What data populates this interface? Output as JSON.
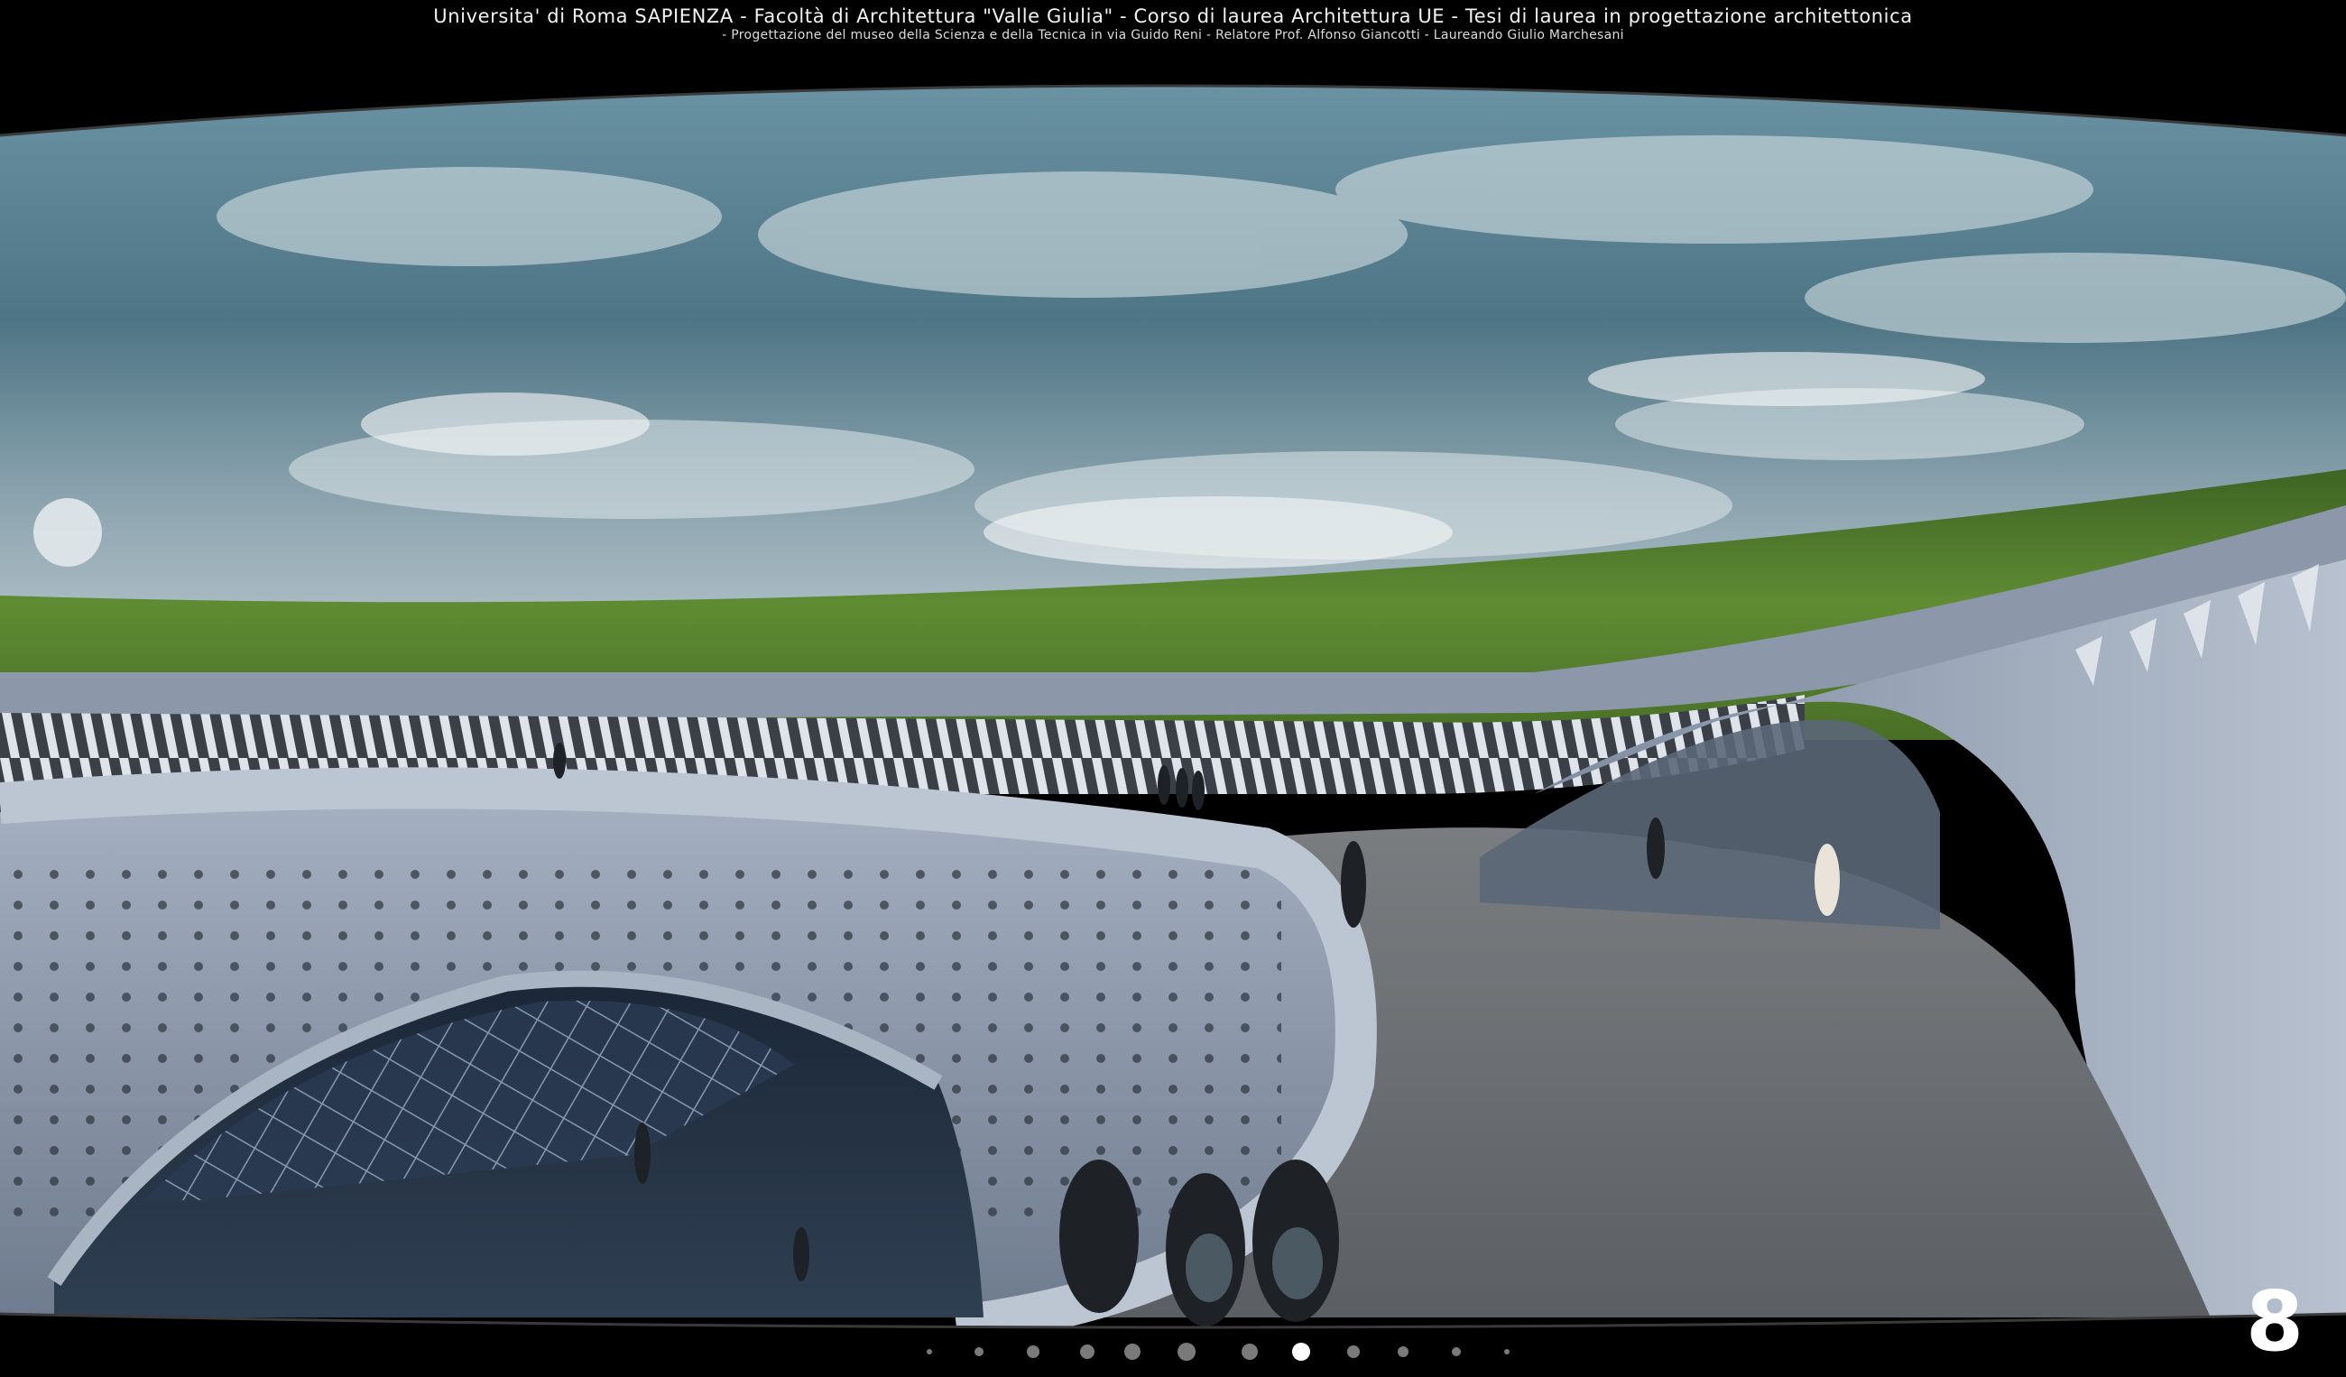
{
  "header": {
    "line1": "Universita' di Roma SAPIENZA  -  Facoltà di Architettura  \"Valle Giulia\"  -  Corso di laurea  Architettura UE  -  Tesi di laurea in progettazione architettonica",
    "line2": "-  Progettazione del museo della Scienza e della Tecnica in via Guido Reni - Relatore Prof.  Alfonso Giancotti  -  Laureando Giulio Marchesani"
  },
  "slide": {
    "number": "8",
    "total": 12,
    "active_index": 7
  },
  "colors": {
    "frame": "#000000",
    "sky": "#5d8494",
    "grass": "#4f7a2a",
    "structure": "#8e9bad",
    "floor": "#6f7378",
    "dot_inactive": "#7a7a7a",
    "dot_active": "#ffffff"
  }
}
